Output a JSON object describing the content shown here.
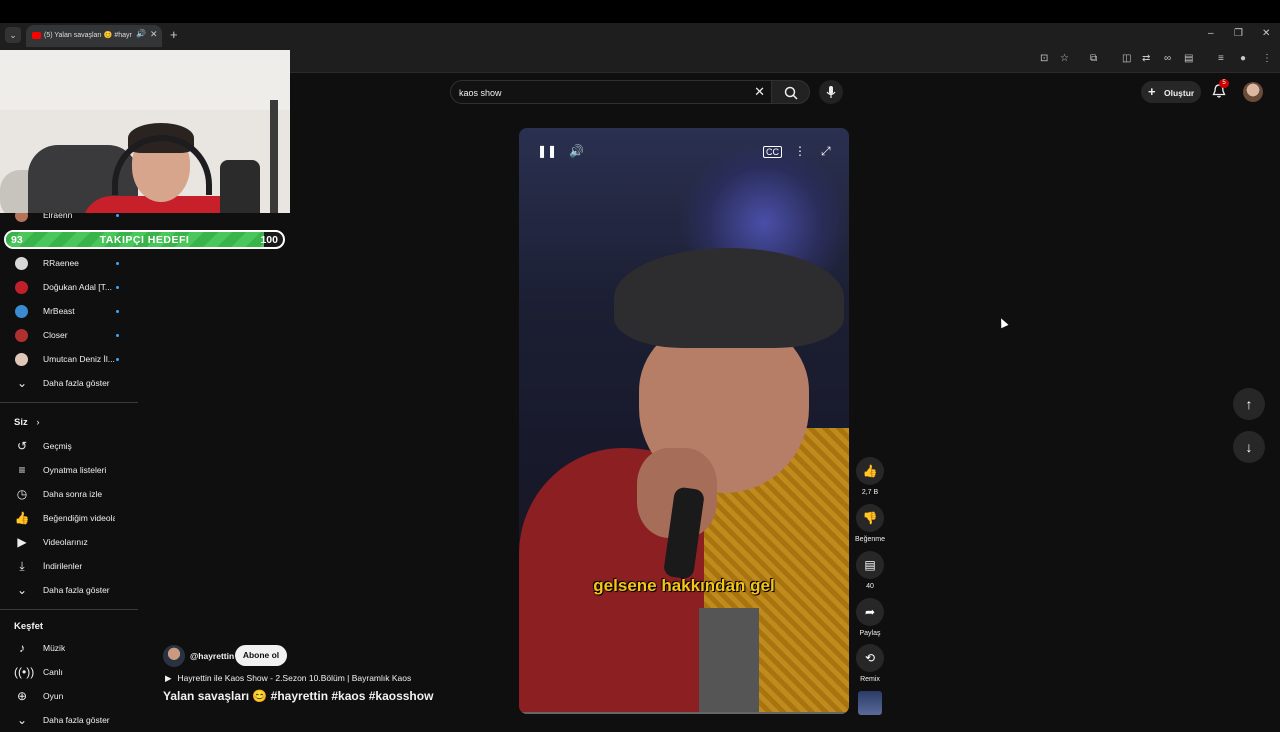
{
  "browser": {
    "tab_title": "(5) Yalan savaşları 😊 #hayr",
    "tab_mute_icon": "speaker-icon",
    "new_tab": "+",
    "window_controls": [
      "–",
      "❐",
      "✕"
    ]
  },
  "search": {
    "query": "kaos show"
  },
  "header": {
    "create_label": "Oluştur",
    "notification_count": "5"
  },
  "goal": {
    "start": "93",
    "label": "TAKIPÇI HEDEFI",
    "end": "100",
    "progress": 0.93
  },
  "sidebar": {
    "subscriptions": [
      {
        "label": "Elraenn",
        "color": "#b5735a"
      },
      {
        "label": "RRaenee",
        "color": "#d8d8d8"
      },
      {
        "label": "Doğukan Adal [T...",
        "color": "#c0202a"
      },
      {
        "label": "MrBeast",
        "color": "#3a8bd0"
      },
      {
        "label": "Closer",
        "color": "#b03030"
      },
      {
        "label": "Umutcan Deniz İl...",
        "color": "#e0c8b8"
      }
    ],
    "show_more_1": "Daha fazla göster",
    "you_header": "Siz",
    "you_items": [
      {
        "label": "Geçmiş",
        "icon": "history-icon"
      },
      {
        "label": "Oynatma listeleri",
        "icon": "playlist-icon"
      },
      {
        "label": "Daha sonra izle",
        "icon": "clock-icon"
      },
      {
        "label": "Beğendiğim videolar",
        "icon": "thumbs-up-icon"
      },
      {
        "label": "Videolarınız",
        "icon": "play-icon"
      },
      {
        "label": "İndirilenler",
        "icon": "download-icon"
      }
    ],
    "show_more_2": "Daha fazla göster",
    "explore_header": "Keşfet",
    "explore_items": [
      {
        "label": "Müzik",
        "icon": "music-icon"
      },
      {
        "label": "Canlı",
        "icon": "live-icon"
      },
      {
        "label": "Oyun",
        "icon": "gamepad-icon"
      }
    ],
    "show_more_3": "Daha fazla göster"
  },
  "video": {
    "subtitle": "gelsene hakkından gel",
    "likes": "2,7 B",
    "dislike_label": "Beğenme",
    "comments": "40",
    "share_label": "Paylaş",
    "remix_label": "Remix"
  },
  "channel": {
    "handle": "@hayrettin",
    "subscribe_label": "Abone ol",
    "playlist": "Hayrettin ile Kaos Show - 2.Sezon 10.Bölüm | Bayramlık Kaos",
    "title": "Yalan savaşları 😊 #hayrettin #kaos #kaosshow"
  }
}
